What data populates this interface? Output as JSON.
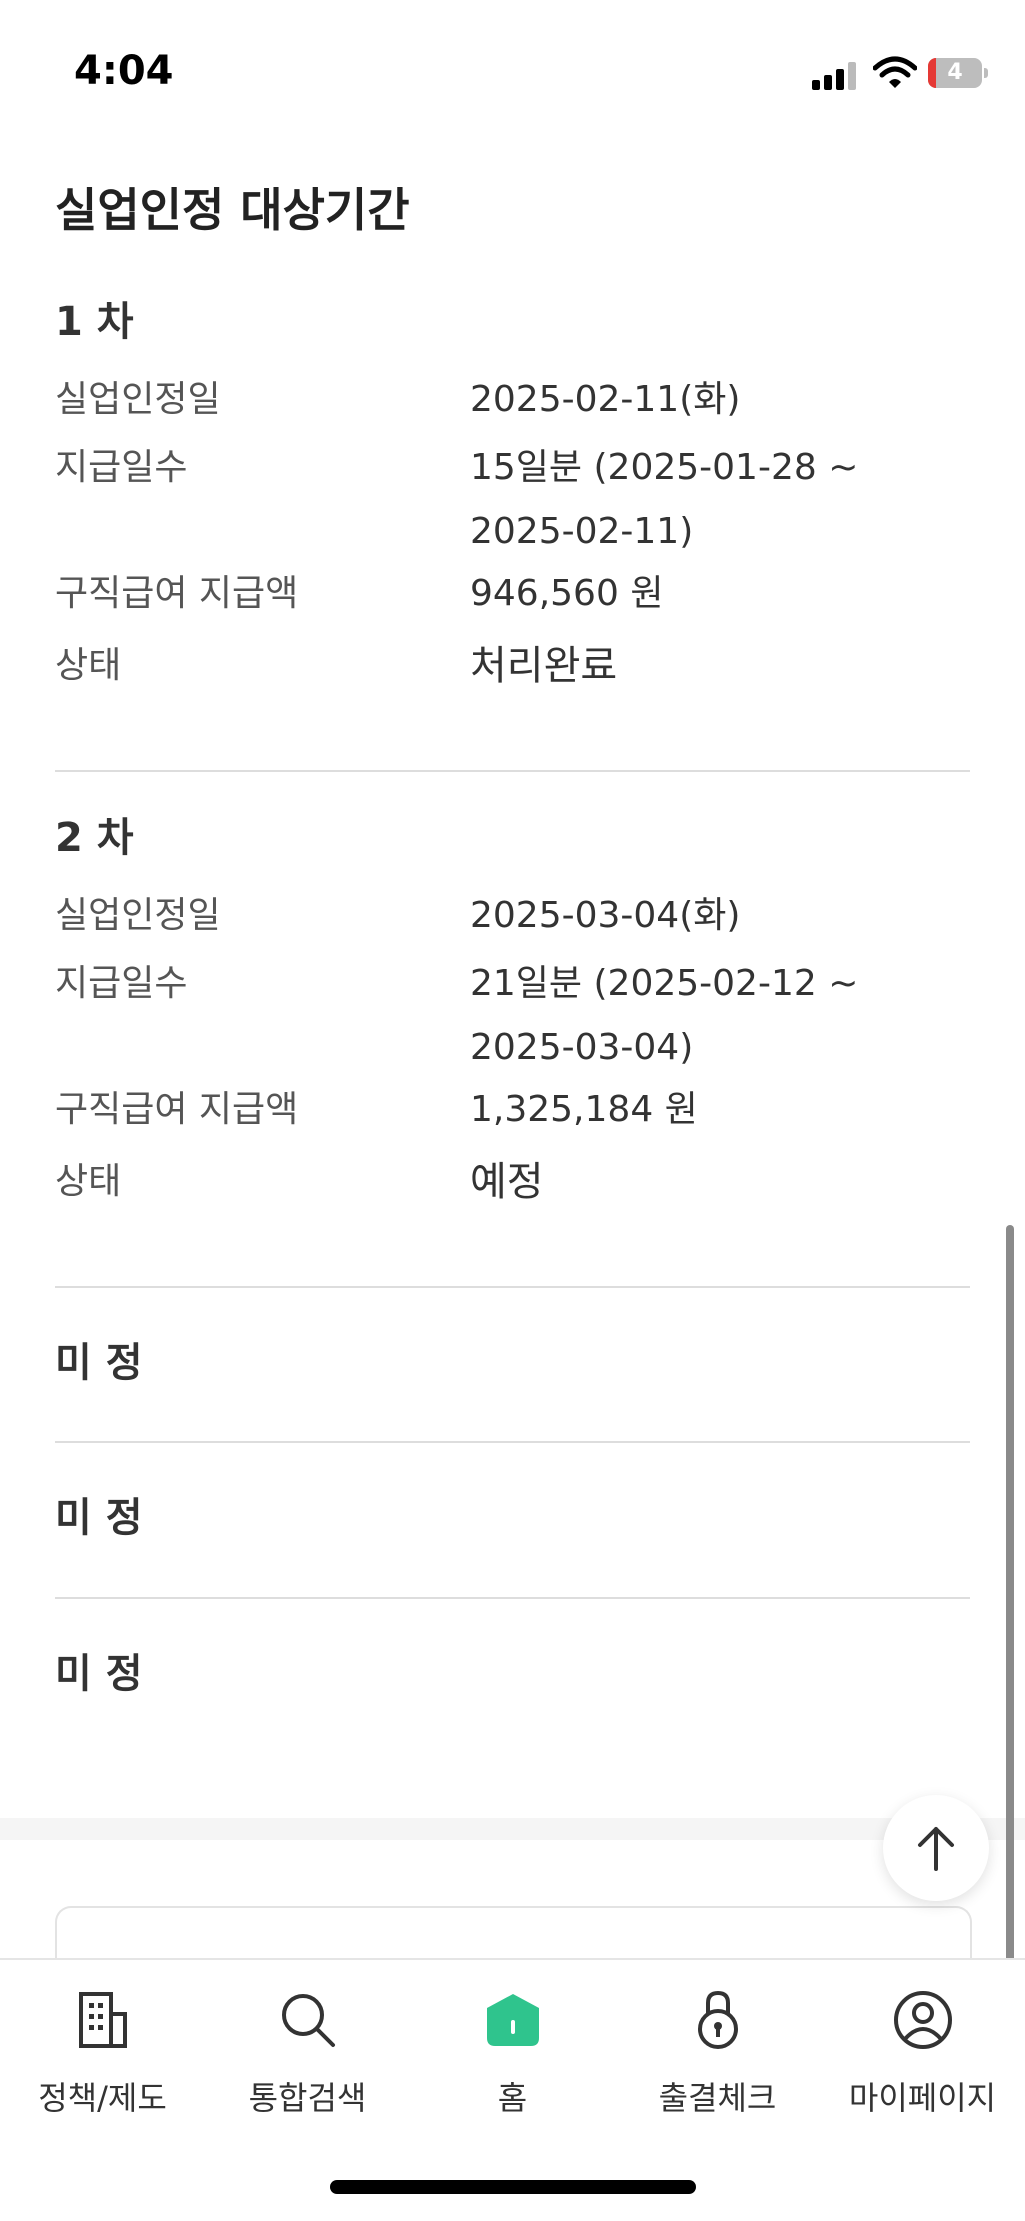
{
  "status_bar": {
    "time": "4:04",
    "battery_level": "4"
  },
  "section": {
    "title": "실업인정 대상기간"
  },
  "rounds": [
    {
      "title": "1 차",
      "recognition_date_label": "실업인정일",
      "recognition_date": "2025-02-11(화)",
      "pay_days_label": "지급일수",
      "pay_days": "15일분 (2025-01-28 ~ 2025-02-11)",
      "amount_label": "구직급여 지급액",
      "amount": "946,560 원",
      "status_label": "상태",
      "status": "처리완료"
    },
    {
      "title": "2 차",
      "recognition_date_label": "실업인정일",
      "recognition_date": "2025-03-04(화)",
      "pay_days_label": "지급일수",
      "pay_days": "21일분 (2025-02-12 ~ 2025-03-04)",
      "amount_label": "구직급여 지급액",
      "amount": "1,325,184 원",
      "status_label": "상태",
      "status": "예정"
    }
  ],
  "pending": [
    "미 정",
    "미 정",
    "미 정"
  ],
  "tabs": [
    {
      "label": "정책/제도",
      "icon": "building-icon"
    },
    {
      "label": "통합검색",
      "icon": "search-icon"
    },
    {
      "label": "홈",
      "icon": "home-icon"
    },
    {
      "label": "출결체크",
      "icon": "lock-icon"
    },
    {
      "label": "마이페이지",
      "icon": "user-icon"
    }
  ],
  "colors": {
    "accent": "#2fc48d",
    "text": "#222222",
    "divider": "#dddddd"
  }
}
